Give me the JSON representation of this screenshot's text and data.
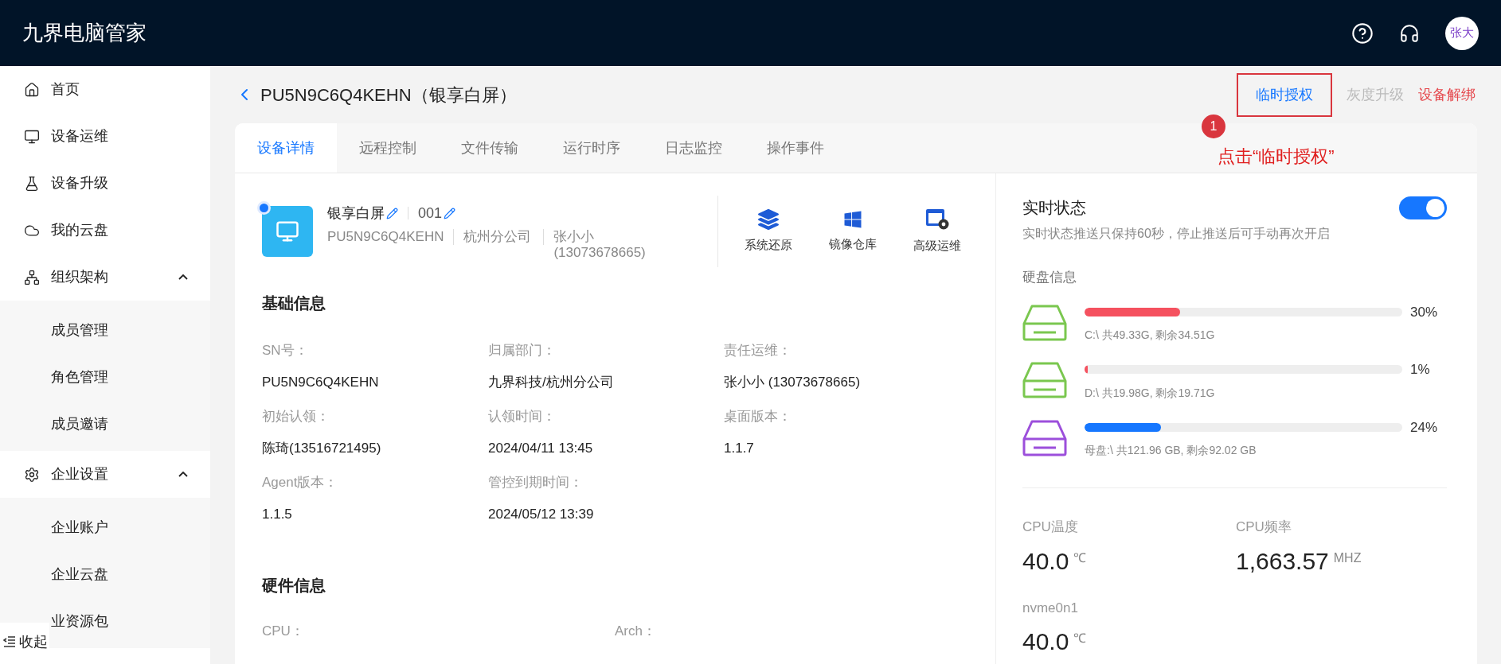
{
  "app": {
    "title": "九界电脑管家",
    "avatar": "张大"
  },
  "sidebar": {
    "items": [
      {
        "label": "首页"
      },
      {
        "label": "设备运维"
      },
      {
        "label": "设备升级"
      },
      {
        "label": "我的云盘"
      },
      {
        "label": "组织架构",
        "expanded": true,
        "children": [
          {
            "label": "成员管理"
          },
          {
            "label": "角色管理"
          },
          {
            "label": "成员邀请"
          }
        ]
      },
      {
        "label": "企业设置",
        "expanded": true,
        "children": [
          {
            "label": "企业账户"
          },
          {
            "label": "企业云盘"
          },
          {
            "label": "业资源包"
          }
        ]
      }
    ],
    "collapse": "收起"
  },
  "header": {
    "title": "PU5N9C6Q4KEHN（银享白屏）",
    "actions": [
      {
        "label": "临时授权",
        "kind": "primary"
      },
      {
        "label": "灰度升级",
        "kind": "disabled"
      },
      {
        "label": "设备解绑",
        "kind": "danger"
      }
    ]
  },
  "annotation": {
    "number": "1",
    "text": "点击“临时授权”"
  },
  "tabs": [
    {
      "label": "设备详情",
      "selected": true
    },
    {
      "label": "远程控制",
      "selected": false
    },
    {
      "label": "文件传输",
      "selected": false
    },
    {
      "label": "运行时序",
      "selected": false
    },
    {
      "label": "日志监控",
      "selected": false
    },
    {
      "label": "操作事件",
      "selected": false
    }
  ],
  "device": {
    "online": true,
    "name": "银享白屏",
    "code": "001",
    "sn": "PU5N9C6Q4KEHN",
    "department": "杭州分公司",
    "owner": "张小小 (13073678665)",
    "actions": [
      "系统还原",
      "镜像仓库",
      "高级运维"
    ]
  },
  "basic_info": {
    "title": "基础信息",
    "fields": [
      {
        "label": "SN号：",
        "value": "PU5N9C6Q4KEHN"
      },
      {
        "label": "归属部门：",
        "value": "九界科技/杭州分公司"
      },
      {
        "label": "责任运维：",
        "value": "张小小 (13073678665)"
      },
      {
        "label": "初始认领：",
        "value": "陈琦(13516721495)"
      },
      {
        "label": "认领时间：",
        "value": "2024/04/11 13:45"
      },
      {
        "label": "桌面版本：",
        "value": "1.1.7"
      },
      {
        "label": "Agent版本：",
        "value": "1.1.5"
      },
      {
        "label": "管控到期时间：",
        "value": "2024/05/12 13:39"
      }
    ]
  },
  "hardware_info": {
    "title": "硬件信息",
    "fields": [
      {
        "label": "CPU："
      },
      {
        "label": "Arch："
      }
    ]
  },
  "realtime": {
    "title": "实时状态",
    "on": true,
    "note": "实时状态推送只保持60秒，停止推送后可手动再次开启",
    "disk_title": "硬盘信息",
    "disks": [
      {
        "color": "#7ac74f",
        "bar": {
          "level": 0.3,
          "color": "#f5515f"
        },
        "usage": "30%",
        "detail": "C:\\ 共49.33G, 剩余34.51G"
      },
      {
        "color": "#7ac74f",
        "bar": {
          "level": 0.01,
          "color": "#f5515f"
        },
        "usage": "1%",
        "detail": "D:\\ 共19.98G, 剩余19.71G"
      },
      {
        "color": "#9c4fdb",
        "bar": {
          "level": 0.24,
          "color": "#1677ff"
        },
        "usage": "24%",
        "detail": "母盘:\\ 共121.96 GB, 剩余92.02 GB"
      }
    ],
    "stats": [
      {
        "label": "CPU温度",
        "value": "40.0",
        "unit": "℃"
      },
      {
        "label": "CPU频率",
        "value": "1,663.57",
        "unit": "MHZ"
      },
      {
        "label": "nvme0n1",
        "value": "40.0",
        "unit": "℃"
      }
    ]
  }
}
